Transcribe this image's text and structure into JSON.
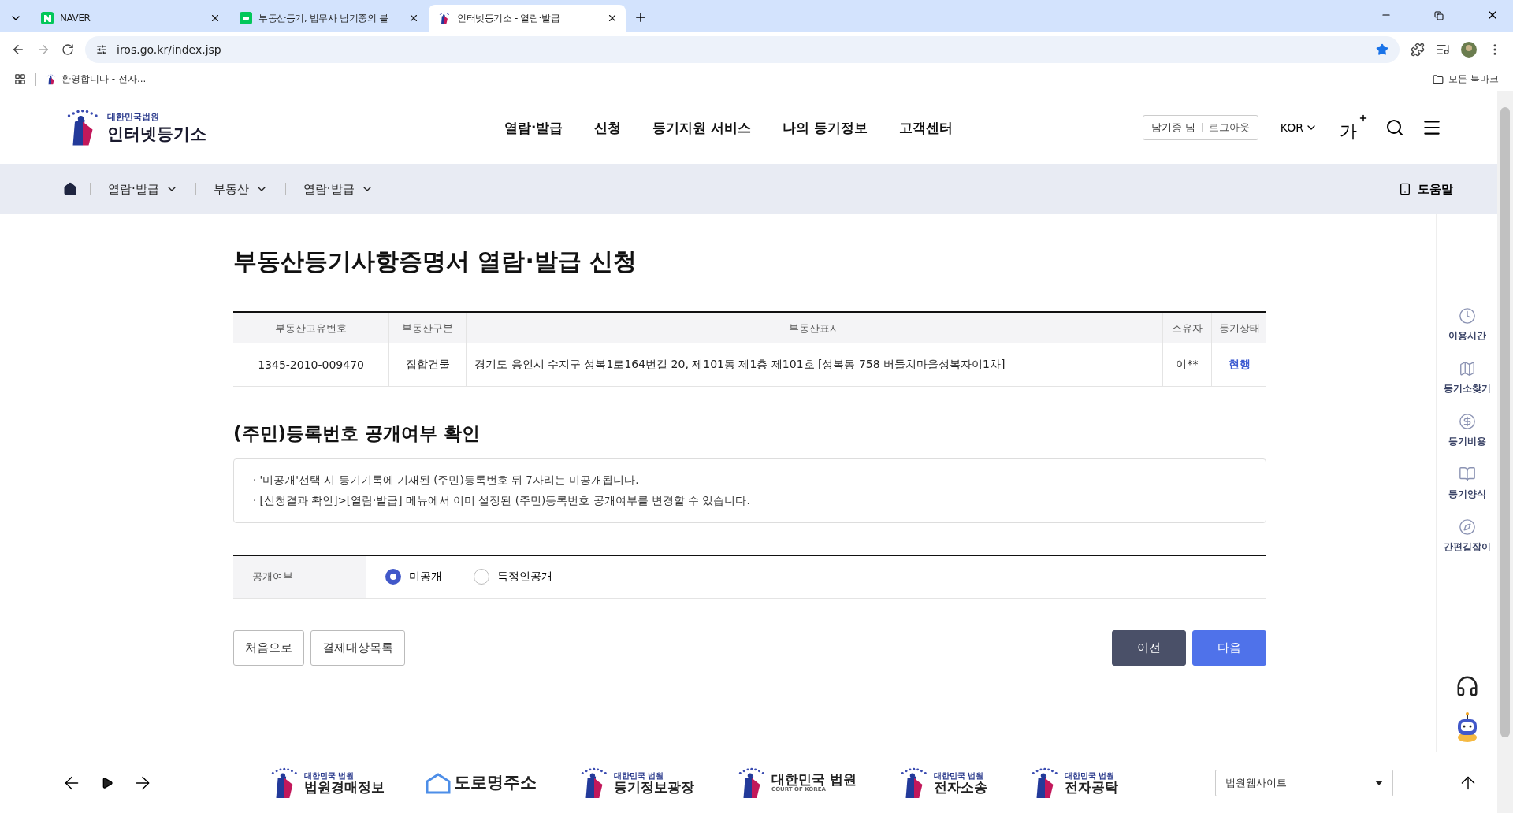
{
  "browser": {
    "tabs": [
      {
        "label": "NAVER",
        "selected": false,
        "kind": "naver"
      },
      {
        "label": "부동산등기, 법무사 남기중의 블",
        "selected": false,
        "kind": "blog"
      },
      {
        "label": "인터넷등기소 - 열람·발급",
        "selected": true,
        "kind": "iros"
      }
    ],
    "url": "iros.go.kr/index.jsp",
    "bookmarks": [
      {
        "label": "환영합니다 - 전자..."
      }
    ],
    "all_bookmarks": "모든 북마크"
  },
  "header": {
    "logo_small": "대한민국법원",
    "logo_big": "인터넷등기소",
    "nav": [
      "열람·발급",
      "신청",
      "등기지원 서비스",
      "나의 등기정보",
      "고객센터"
    ],
    "user": "남기중 님",
    "logout": "로그아웃",
    "lang": "KOR",
    "font_size": "가"
  },
  "breadcrumb": [
    "열람·발급",
    "부동산",
    "열람·발급"
  ],
  "help": "도움말",
  "title": "부동산등기사항증명서 열람·발급 신청",
  "table": {
    "columns": [
      "부동산고유번호",
      "부동산구분",
      "부동산표시",
      "소유자",
      "등기상태"
    ],
    "rows": [
      [
        "1345-2010-009470",
        "집합건물",
        "경기도 용인시 수지구 성복1로164번길 20, 제101동 제1층 제101호 [성복동 758 버들치마을성복자이1차]",
        "이**",
        "현행"
      ]
    ]
  },
  "section_title": "(주민)등록번호 공개여부 확인",
  "notices": [
    "· '미공개'선택 시 등기기록에 기재된 (주민)등록번호 뒤 7자리는 미공개됩니다.",
    "· [신청결과 확인]>[열람·발급] 메뉴에서 이미 설정된 (주민)등록번호 공개여부를 변경할 수 있습니다."
  ],
  "disclosure": {
    "label": "공개여부",
    "options": [
      {
        "label": "미공개",
        "selected": true
      },
      {
        "label": "특정인공개",
        "selected": false
      }
    ]
  },
  "buttons_left": [
    "처음으로",
    "결제대상목록"
  ],
  "buttons_right": [
    {
      "label": "이전",
      "kind": "dark"
    },
    {
      "label": "다음",
      "kind": "primary"
    }
  ],
  "quick_menu": [
    {
      "label": "이용시간",
      "kind": "clock"
    },
    {
      "label": "등기소찾기",
      "kind": "map"
    },
    {
      "label": "등기비용",
      "kind": "coin"
    },
    {
      "label": "등기양식",
      "kind": "book"
    },
    {
      "label": "간편길잡이",
      "kind": "compass"
    }
  ],
  "footer": {
    "sites": [
      {
        "small": "대한민국 법원",
        "big": "법원경매정보",
        "kind": "court"
      },
      {
        "big": "도로명주소",
        "kind": "road"
      },
      {
        "small": "대한민국 법원",
        "big": "등기정보광장",
        "kind": "court"
      },
      {
        "small": "COURT OF KOREA",
        "big": "대한민국 법원",
        "kind": "korea"
      },
      {
        "small": "대한민국 법원",
        "big": "전자소송",
        "kind": "court"
      },
      {
        "small": "대한민국 법원",
        "big": "전자공탁",
        "kind": "court"
      }
    ],
    "select": "법원웹사이트"
  }
}
